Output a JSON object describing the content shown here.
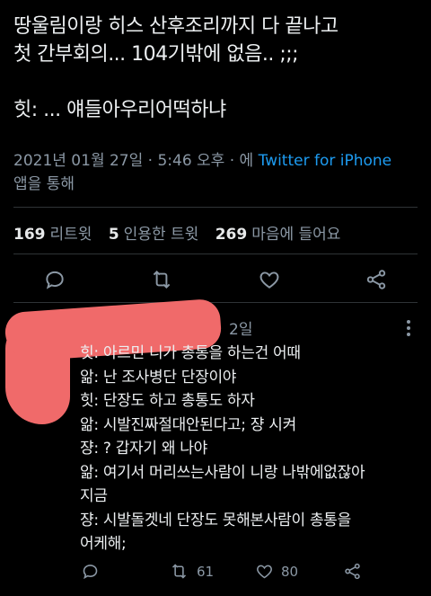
{
  "tweet": {
    "lines": [
      "땅울림이랑 히스 산후조리까지 다 끝나고",
      "첫 간부회의... 104기밖에 없음.. ;;;",
      "힛: ... 얘들아우리어떡하냐"
    ]
  },
  "meta": {
    "date": "2021년 01월 27일 · 5:46 오후 · 에 ",
    "source": "Twitter for iPhone",
    "via": "앱을 통해"
  },
  "stats": {
    "retweets_count": "169",
    "retweets_label": "리트윗",
    "quotes_count": "5",
    "quotes_label": "인용한 트윗",
    "likes_count": "269",
    "likes_label": "마음에 들어요"
  },
  "reply": {
    "time": "2일",
    "lines": [
      "힛: 아르민 니가 총통을 하는건 어때",
      "앎: 난 조사병단 단장이야",
      "힛: 단장도 하고 총통도 하자",
      "앎: 시발진짜절대안된다고; 쟝 시켜",
      "쟝: ? 갑자기 왜 나야",
      "앎: 여기서 머리쓰는사람이 니랑 나밖에없잖아",
      "지금",
      "쟝: 시발돌겟네 단장도 못해본사람이 총통을",
      "어케해;"
    ],
    "retweet_count": "61",
    "like_count": "80"
  },
  "colors": {
    "background": "#000000",
    "text": "#e7e9ea",
    "muted": "#8b98a5",
    "link": "#1d9bf0",
    "redaction": "#f06a6a"
  }
}
